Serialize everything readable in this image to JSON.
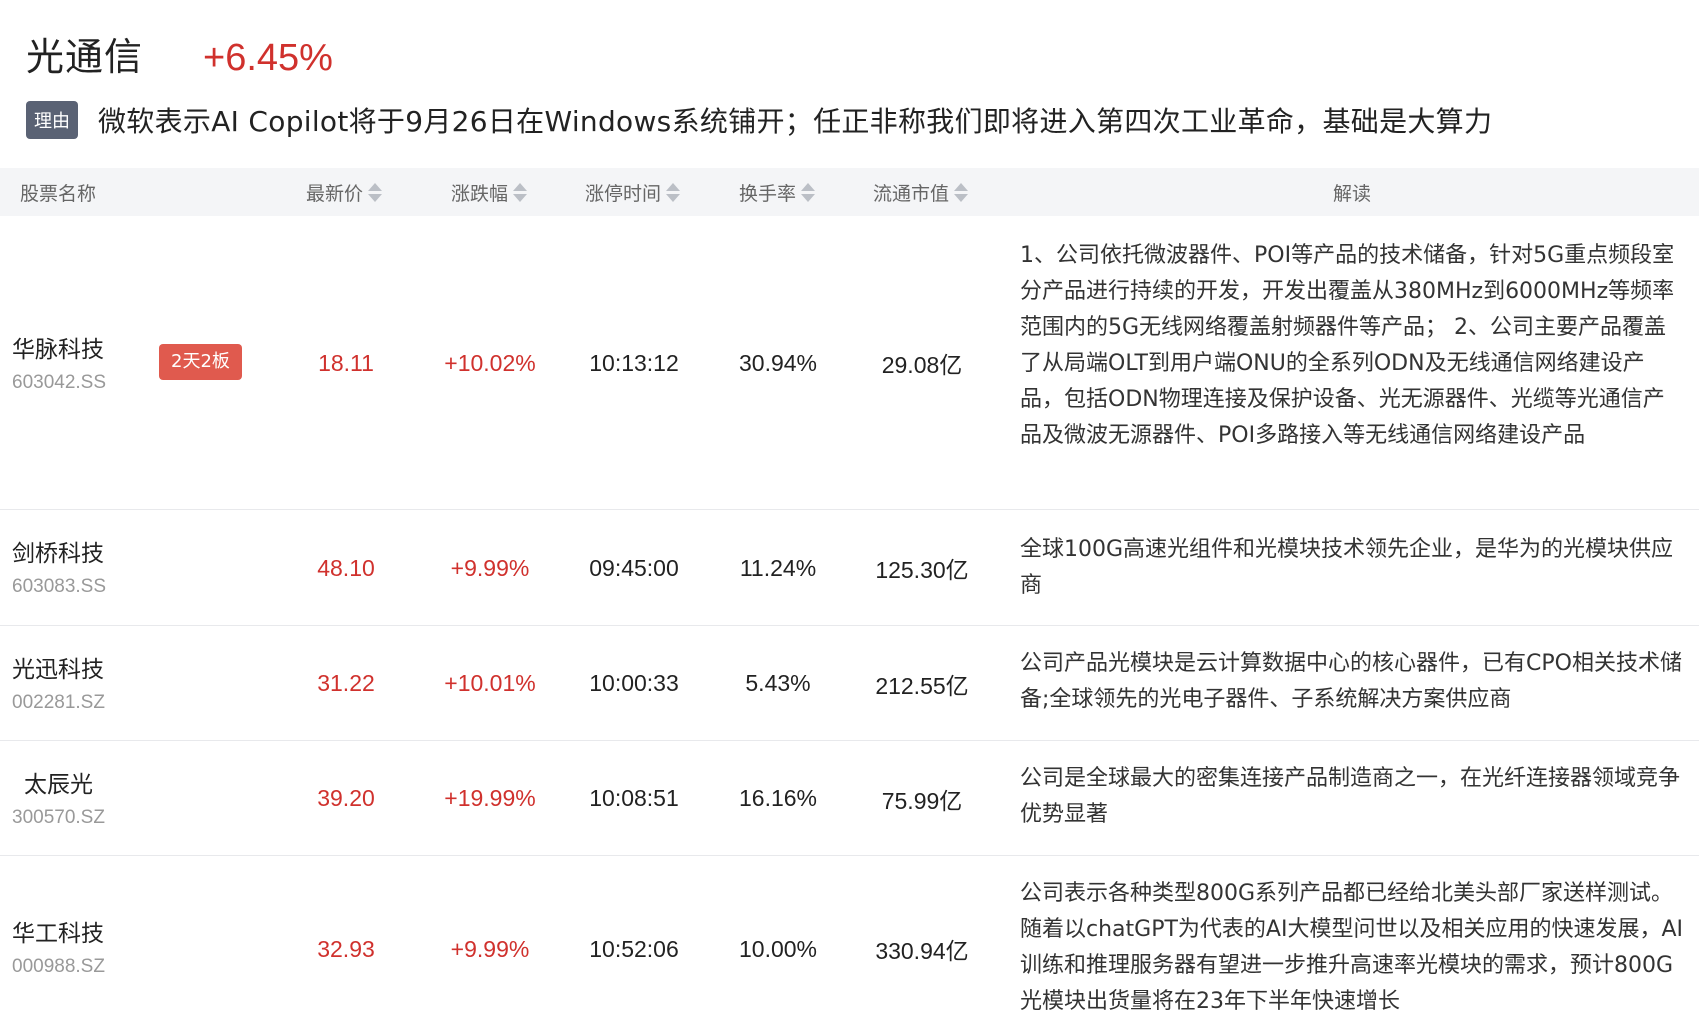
{
  "sector": {
    "name": "光通信",
    "change": "+6.45%"
  },
  "reason": {
    "tag": "理由",
    "text": "微软表示AI Copilot将于9月26日在Windows系统铺开；任正非称我们即将进入第四次工业革命，基础是大算力"
  },
  "columns": {
    "name": "股票名称",
    "price": "最新价",
    "change": "涨跌幅",
    "limit_time": "涨停时间",
    "turnover": "换手率",
    "market_cap": "流通市值",
    "analysis": "解读"
  },
  "rows": [
    {
      "name": "华脉科技",
      "code": "603042.SS",
      "badge": "2天2板",
      "price": "18.11",
      "change": "+10.02%",
      "limit_time": "10:13:12",
      "turnover": "30.94%",
      "market_cap": "29.08亿",
      "analysis": "1、公司依托微波器件、POI等产品的技术储备，针对5G重点频段室分产品进行持续的开发，开发出覆盖从380MHz到6000MHz等频率范围内的5G无线网络覆盖射频器件等产品； 2、公司主要产品覆盖了从局端OLT到用户端ONU的全系列ODN及无线通信网络建设产品，包括ODN物理连接及保护设备、光无源器件、光缆等光通信产品及微波无源器件、POI多路接入等无线通信网络建设产品"
    },
    {
      "name": "剑桥科技",
      "code": "603083.SS",
      "badge": "",
      "price": "48.10",
      "change": "+9.99%",
      "limit_time": "09:45:00",
      "turnover": "11.24%",
      "market_cap": "125.30亿",
      "analysis": "全球100G高速光组件和光模块技术领先企业，是华为的光模块供应商"
    },
    {
      "name": "光迅科技",
      "code": "002281.SZ",
      "badge": "",
      "price": "31.22",
      "change": "+10.01%",
      "limit_time": "10:00:33",
      "turnover": "5.43%",
      "market_cap": "212.55亿",
      "analysis": "公司产品光模块是云计算数据中心的核心器件，已有CPO相关技术储备;全球领先的光电子器件、子系统解决方案供应商"
    },
    {
      "name": "太辰光",
      "code": "300570.SZ",
      "badge": "",
      "price": "39.20",
      "change": "+19.99%",
      "limit_time": "10:08:51",
      "turnover": "16.16%",
      "market_cap": "75.99亿",
      "analysis": "公司是全球最大的密集连接产品制造商之一，在光纤连接器领域竞争优势显著"
    },
    {
      "name": "华工科技",
      "code": "000988.SZ",
      "badge": "",
      "price": "32.93",
      "change": "+9.99%",
      "limit_time": "10:52:06",
      "turnover": "10.00%",
      "market_cap": "330.94亿",
      "analysis": "公司表示各种类型800G系列产品都已经给北美头部厂家送样测试。随着以chatGPT为代表的AI大模型问世以及相关应用的快速发展，AI训练和推理服务器有望进一步推升高速率光模块的需求，预计800G光模块出货量将在23年下半年快速增长"
    }
  ]
}
